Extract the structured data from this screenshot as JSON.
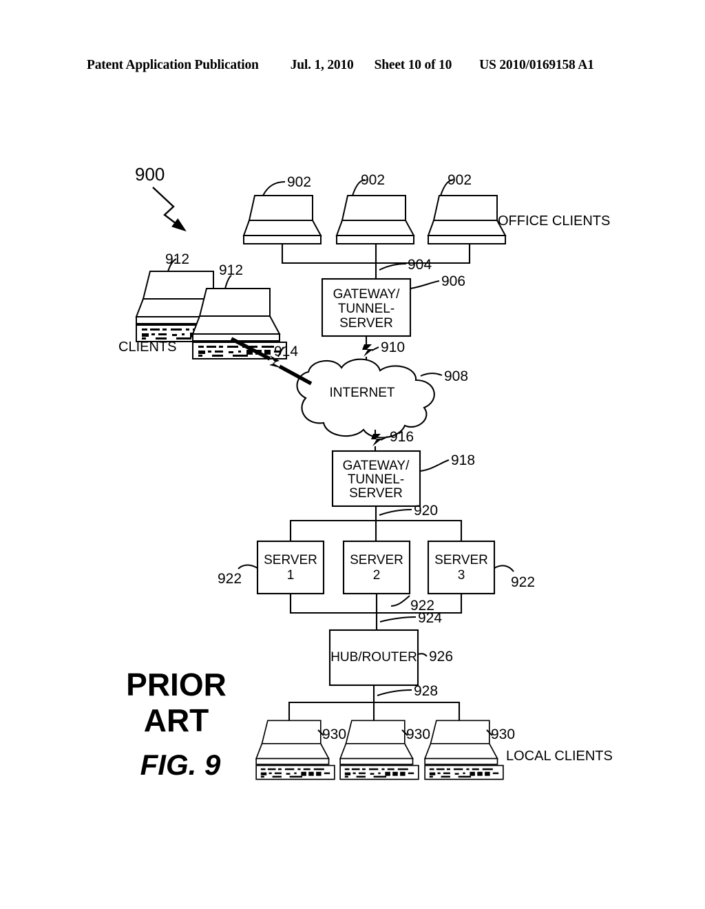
{
  "header": {
    "publication": "Patent Application Publication",
    "date": "Jul. 1, 2010",
    "sheet": "Sheet 10 of 10",
    "document_number": "US 2010/0169158 A1"
  },
  "figure": {
    "caption_line1": "PRIOR",
    "caption_line2": "ART",
    "caption_number": "FIG. 9",
    "system_ref": "900"
  },
  "group_labels": {
    "office_clients": "OFFICE CLIENTS",
    "clients": "CLIENTS",
    "local_clients": "LOCAL CLIENTS"
  },
  "nodes": {
    "office_client_1": {
      "ref": "902"
    },
    "office_client_2": {
      "ref": "902"
    },
    "office_client_3": {
      "ref": "902"
    },
    "office_bus": {
      "ref": "904"
    },
    "gateway_top": {
      "ref": "906",
      "line1": "GATEWAY/",
      "line2": "TUNNEL-",
      "line3": "SERVER"
    },
    "link_gateway_internet": {
      "ref": "910"
    },
    "internet": {
      "ref": "908",
      "label": "INTERNET"
    },
    "remote_client_1": {
      "ref": "912"
    },
    "remote_client_2": {
      "ref": "912"
    },
    "wireless_link": {
      "ref": "914"
    },
    "link_internet_gateway": {
      "ref": "916"
    },
    "gateway_bottom": {
      "ref": "918",
      "line1": "GATEWAY/",
      "line2": "TUNNEL-",
      "line3": "SERVER"
    },
    "server_bus_top": {
      "ref": "920"
    },
    "server_1": {
      "ref": "922",
      "line1": "SERVER",
      "line2": "1"
    },
    "server_2": {
      "ref": "922",
      "line1": "SERVER",
      "line2": "2"
    },
    "server_3": {
      "ref": "922",
      "line1": "SERVER",
      "line2": "3"
    },
    "server_bus_bottom": {
      "ref": "924"
    },
    "hub_router": {
      "ref": "926",
      "label": "HUB/ROUTER"
    },
    "local_bus": {
      "ref": "928"
    },
    "local_client_1": {
      "ref": "930"
    },
    "local_client_2": {
      "ref": "930"
    },
    "local_client_3": {
      "ref": "930"
    }
  },
  "colors": {
    "ink": "#000000",
    "paper": "#ffffff"
  }
}
